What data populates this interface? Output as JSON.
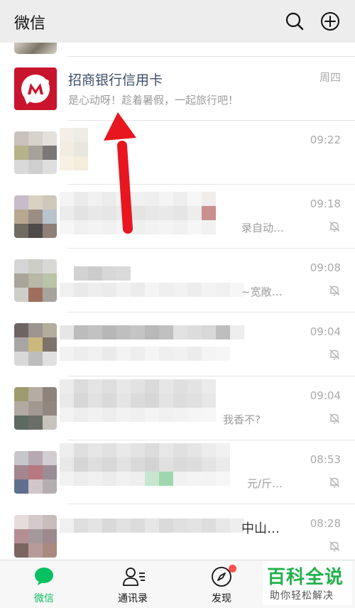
{
  "header": {
    "title": "微信"
  },
  "chats": [
    {
      "name": "招商银行信用卡",
      "preview": "是心动呀！趁着暑假，一起旅行吧！",
      "time": "周四",
      "muted": false
    },
    {
      "name": "",
      "preview": "",
      "time": "09:22",
      "muted": false
    },
    {
      "name": "",
      "preview": "录自动…",
      "time": "09:18",
      "muted": true
    },
    {
      "name": "",
      "preview": "~宽敞…",
      "time": "09:08",
      "muted": true
    },
    {
      "name": "",
      "preview": "",
      "time": "09:04",
      "muted": true
    },
    {
      "name": "",
      "preview": "我香不?",
      "time": "09:04",
      "muted": true
    },
    {
      "name": "",
      "preview": "元/斤…",
      "time": "08:53",
      "muted": true
    },
    {
      "name": "",
      "preview": "中山…",
      "time": "08:28",
      "muted": true
    }
  ],
  "tabs": [
    {
      "label": "微信"
    },
    {
      "label": "通讯录"
    },
    {
      "label": "发现"
    }
  ],
  "watermark": {
    "main": "百科全说",
    "sub": "助你轻松解决"
  },
  "colors": {
    "accent": "#07c160",
    "badge": "#fa5151",
    "arrow": "#e8161e",
    "bank_logo": "#c8152d"
  }
}
